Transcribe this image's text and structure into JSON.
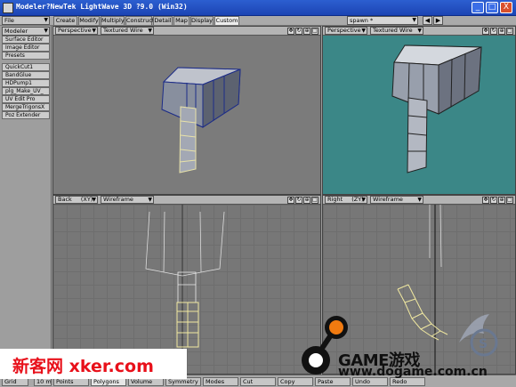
{
  "window": {
    "title": "Modeler?NewTek LightWave 3D ?9.0 (Win32)",
    "controls": {
      "minimize": "_",
      "maximize": "□",
      "close": "X"
    }
  },
  "top": {
    "file_menu": "File",
    "modeler_menu": "Modeler",
    "tabs": [
      {
        "label": "Create",
        "active": false
      },
      {
        "label": "Modify",
        "active": false
      },
      {
        "label": "Multiply",
        "active": false
      },
      {
        "label": "Construct",
        "active": false
      },
      {
        "label": "Detail",
        "active": false
      },
      {
        "label": "Map",
        "active": false
      },
      {
        "label": "Display",
        "active": false
      },
      {
        "label": "Custom",
        "active": true
      }
    ],
    "object_select": "spawn *",
    "tool_icons": [
      "back-arrow-icon",
      "forward-arrow-icon"
    ]
  },
  "sidebar": {
    "items": [
      {
        "label": "Surface Editor"
      },
      {
        "label": "Image Editor"
      },
      {
        "label": "Presets"
      },
      {
        "label": "QuickCut1"
      },
      {
        "label": "BandGlue"
      },
      {
        "label": "HDPump1"
      },
      {
        "label": "plg_Make_UV_"
      },
      {
        "label": "UV Edit Pro"
      },
      {
        "label": "MergeTrigonsX"
      },
      {
        "label": "Poz Extender"
      }
    ]
  },
  "viewports": [
    {
      "view": "Perspective",
      "axis": "",
      "mode": "Textured Wire",
      "background": "#7b7b7b"
    },
    {
      "view": "Perspective",
      "axis": "",
      "mode": "Textured Wire",
      "background": "#3b8787"
    },
    {
      "view": "Back",
      "axis": "(XY)",
      "mode": "Wireframe",
      "background": "#777777"
    },
    {
      "view": "Right",
      "axis": "(ZY)",
      "mode": "Wireframe",
      "background": "#777777"
    }
  ],
  "viewport_icons": [
    "move-view-icon",
    "rotate-view-icon",
    "zoom-view-icon",
    "maximize-view-icon"
  ],
  "bottom": {
    "items": [
      {
        "label": "Grid"
      },
      {
        "label": "10 m"
      },
      {
        "label": "Points"
      },
      {
        "label": "Polygons"
      },
      {
        "label": "Volume"
      },
      {
        "label": "Symmetry"
      },
      {
        "label": "Modes"
      },
      {
        "label": "Cut"
      },
      {
        "label": "Copy"
      },
      {
        "label": "Paste"
      },
      {
        "label": "Undo"
      },
      {
        "label": "Redo"
      }
    ]
  },
  "watermarks": {
    "left_text": "新客网 xker.com",
    "game_text": "GAME游戏",
    "url_text": "www.dogame.com.cn",
    "colors": {
      "left_text": "#e8101a",
      "logo_orange": "#f07a10",
      "logo_black": "#111111"
    }
  }
}
